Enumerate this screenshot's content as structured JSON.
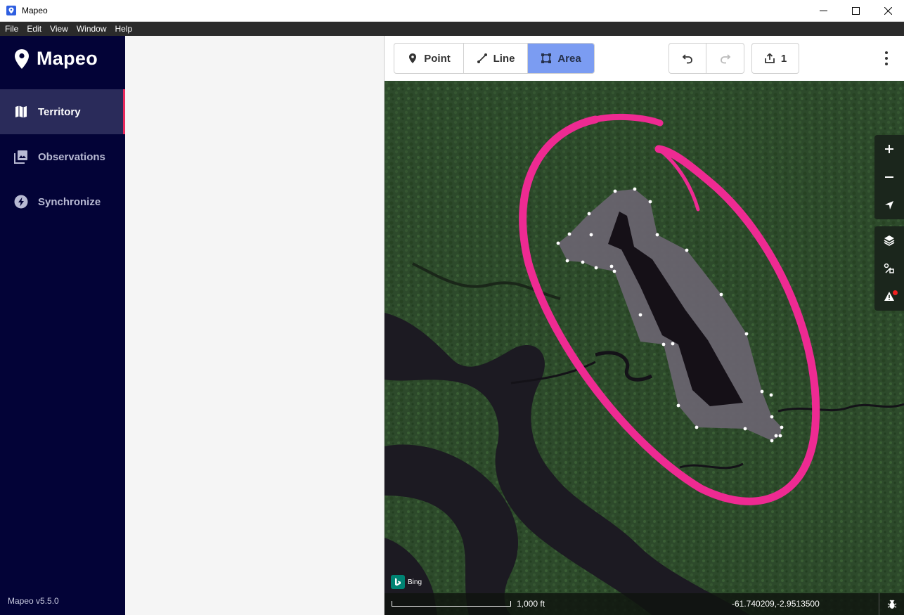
{
  "window": {
    "title": "Mapeo"
  },
  "menu": {
    "items": [
      "File",
      "Edit",
      "View",
      "Window",
      "Help"
    ]
  },
  "sidebar": {
    "brand": "Mapeo",
    "items": [
      {
        "label": "Territory",
        "icon": "map-icon",
        "active": true
      },
      {
        "label": "Observations",
        "icon": "photo-library-icon",
        "active": false
      },
      {
        "label": "Synchronize",
        "icon": "flash-icon",
        "active": false
      }
    ],
    "version": "Mapeo v5.5.0"
  },
  "toolbar": {
    "point_label": "Point",
    "line_label": "Line",
    "area_label": "Area",
    "active_mode": "Area",
    "upload_count": "1"
  },
  "map": {
    "attribution": "Bing",
    "scale_label": "1,000 ft",
    "coordinates": "-61.740209,-2.9513500",
    "has_notification": true
  },
  "colors": {
    "sidebar_bg": "#030337",
    "active_indicator": "#e8295d",
    "active_mode_bg": "#7b9cf2",
    "annotation_ellipse": "#ee2a92",
    "polygon_fill": "#6a6470"
  }
}
